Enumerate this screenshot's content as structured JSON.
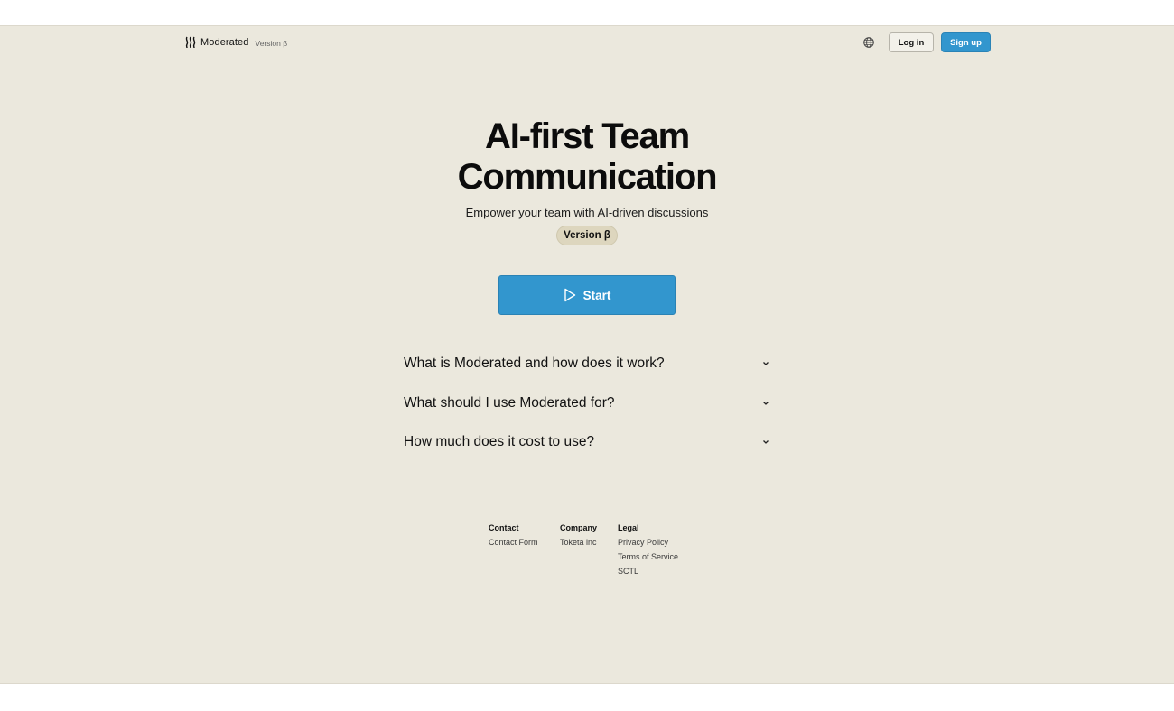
{
  "header": {
    "brand_name": "Moderated",
    "brand_version": "Version β",
    "login_label": "Log in",
    "signup_label": "Sign up"
  },
  "hero": {
    "title_line1": "AI-first Team",
    "title_line2": "Communication",
    "subtitle": "Empower your team with AI-driven discussions",
    "version_badge": "Version β",
    "start_label": "Start"
  },
  "faq": {
    "items": [
      {
        "question": "What is Moderated and how does it work?"
      },
      {
        "question": "What should I use Moderated for?"
      },
      {
        "question": "How much does it cost to use?"
      }
    ]
  },
  "footer": {
    "contact": {
      "heading": "Contact",
      "links": [
        "Contact Form"
      ]
    },
    "company": {
      "heading": "Company",
      "links": [
        "Toketa inc"
      ]
    },
    "legal": {
      "heading": "Legal",
      "links": [
        "Privacy Policy",
        "Terms of Service",
        "SCTL"
      ]
    }
  },
  "colors": {
    "background": "#ebe8dd",
    "accent": "#3296ce",
    "badge": "#ddd6be"
  },
  "icons": {
    "brand": "moderated-logo-icon",
    "language": "globe-icon",
    "start": "play-icon",
    "expand": "chevron-down-icon"
  }
}
